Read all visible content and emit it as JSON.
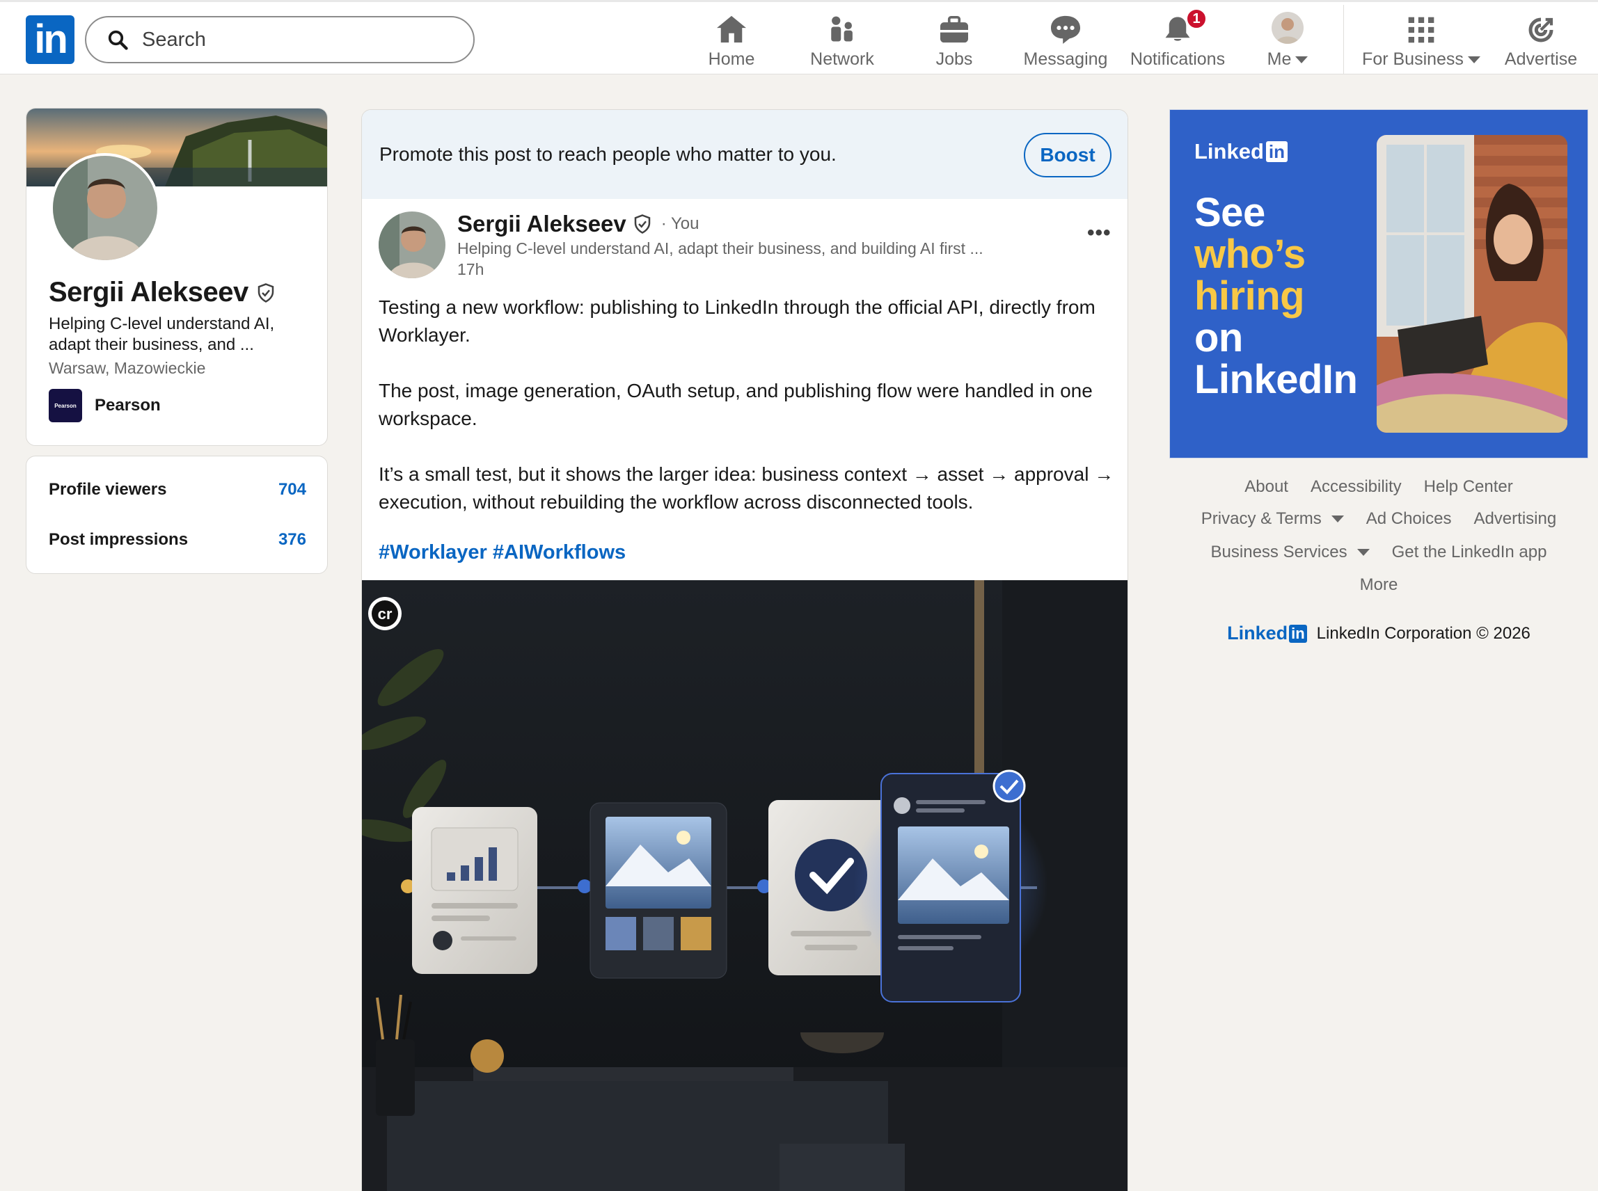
{
  "nav": {
    "logo": "in",
    "search_placeholder": "Search",
    "items": [
      {
        "label": "Home",
        "icon": "home-icon"
      },
      {
        "label": "Network",
        "icon": "network-icon"
      },
      {
        "label": "Jobs",
        "icon": "briefcase-icon"
      },
      {
        "label": "Messaging",
        "icon": "messaging-icon"
      },
      {
        "label": "Notifications",
        "icon": "bell-icon",
        "badge": "1"
      },
      {
        "label": "Me",
        "icon": "avatar"
      },
      {
        "label": "For Business",
        "icon": "grid-icon"
      },
      {
        "label": "Advertise",
        "icon": "advertise-icon"
      }
    ]
  },
  "profile": {
    "name": "Sergii Alekseev",
    "headline": "Helping C-level understand AI, adapt their business, and ...",
    "location": "Warsaw, Mazowieckie",
    "company": "Pearson",
    "company_logo_text": "Pearson"
  },
  "stats": [
    {
      "label": "Profile viewers",
      "value": "704"
    },
    {
      "label": "Post impressions",
      "value": "376"
    }
  ],
  "promo": {
    "text": "Promote this post to reach people who matter to you.",
    "button": "Boost"
  },
  "post": {
    "author": "Sergii Alekseev",
    "you": "· You",
    "subtitle": "Helping C-level understand AI, adapt their business, and building AI first ...",
    "time": "17h",
    "paragraphs": [
      "Testing a new workflow: publishing to LinkedIn through the official API, directly from Worklayer.",
      "The post, image generation, OAuth setup, and publishing flow were handled in one workspace.",
      "It’s a small test, but it shows the larger idea: business context → asset → approval → execution, without rebuilding the workflow across disconnected tools."
    ],
    "hashtags": [
      "#Worklayer",
      "#AIWorkflows"
    ],
    "image_badge": "cr"
  },
  "ad": {
    "brand": "Linked",
    "brand_in": "in",
    "line1": "See",
    "line2": "who’s",
    "line3": "hiring",
    "line4": "on",
    "line5": "LinkedIn",
    "accent_color": "#f8c846",
    "bg_color": "#2f61c8"
  },
  "footer": {
    "row1": [
      "About",
      "Accessibility",
      "Help Center"
    ],
    "row2": [
      "Privacy & Terms",
      "Ad Choices",
      "Advertising"
    ],
    "row3": [
      "Business Services",
      "Get the LinkedIn app"
    ],
    "row4": [
      "More"
    ],
    "brand": "Linked",
    "brand_in": "in",
    "copyright": "LinkedIn Corporation © 2026"
  }
}
